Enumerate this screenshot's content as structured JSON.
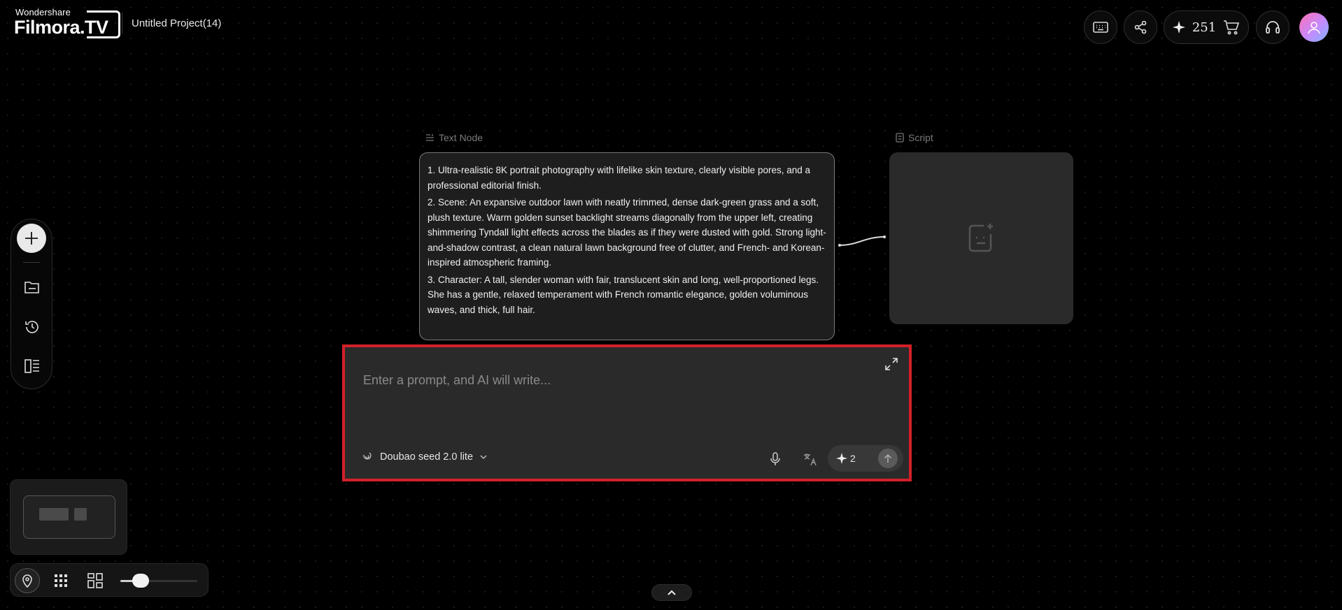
{
  "header": {
    "brand_top": "Wondershare",
    "brand_main": "Filmora.TV",
    "project_title": "Untitled Project(14)",
    "credits": "251",
    "buttons": [
      "keyboard-shortcuts",
      "share",
      "credits",
      "cart",
      "support",
      "account"
    ]
  },
  "text_node": {
    "label": "Text Node",
    "paragraphs": [
      "1. Ultra-realistic 8K portrait photography with lifelike skin texture, clearly visible pores, and a professional editorial finish.",
      "2. Scene: An expansive outdoor lawn with neatly trimmed, dense dark-green grass and a soft, plush texture. Warm golden sunset backlight streams diagonally from the upper left, creating shimmering Tyndall light effects across the blades as if they were dusted with gold. Strong light-and-shadow contrast, a clean natural lawn background free of clutter, and French- and Korean-inspired atmospheric framing.",
      "3. Character: A tall, slender woman with fair, translucent skin and long, well-proportioned legs. She has a gentle, relaxed temperament with French romantic elegance, golden voluminous waves, and thick, full hair."
    ]
  },
  "script_node": {
    "label": "Script"
  },
  "prompt": {
    "placeholder": "Enter a prompt, and AI will write...",
    "value": "",
    "model": "Doubao seed 2.0 lite",
    "cost": "2"
  },
  "zoom": {
    "level_fraction": 0.2
  },
  "colors": {
    "highlight_border": "#d32029",
    "background": "#000000",
    "panel": "#2a2a2a"
  }
}
